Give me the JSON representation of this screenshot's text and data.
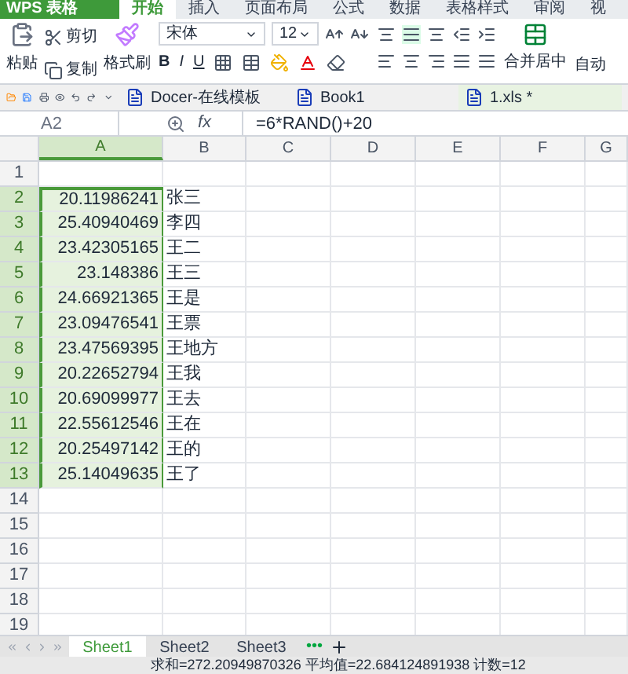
{
  "app_menu": {
    "label": "WPS 表格"
  },
  "menu_tabs": [
    {
      "label": "开始",
      "selected": true
    },
    {
      "label": "插入",
      "selected": false
    },
    {
      "label": "页面布局",
      "selected": false
    },
    {
      "label": "公式",
      "selected": false
    },
    {
      "label": "数据",
      "selected": false
    },
    {
      "label": "表格样式",
      "selected": false
    },
    {
      "label": "审阅",
      "selected": false
    },
    {
      "label": "视",
      "selected": false
    }
  ],
  "ribbon": {
    "paste": "粘贴",
    "cut": "剪切",
    "copy": "复制",
    "format_painter": "格式刷",
    "font": "宋体",
    "font_size": "12",
    "bold": "B",
    "italic": "I",
    "underline": "U",
    "merge": "合并居中",
    "auto": "自动"
  },
  "doc_tabs": [
    {
      "label": "Docer-在线模板",
      "selected": false
    },
    {
      "label": "Book1",
      "selected": false
    },
    {
      "label": "1.xls *",
      "selected": true
    }
  ],
  "formula_bar": {
    "name_box": "A2",
    "fx": "fx",
    "formula": "=6*RAND()+20"
  },
  "columns": [
    {
      "label": "A",
      "selected": true
    },
    {
      "label": "B",
      "selected": false
    },
    {
      "label": "C",
      "selected": false
    },
    {
      "label": "D",
      "selected": false
    },
    {
      "label": "E",
      "selected": false
    },
    {
      "label": "F",
      "selected": false
    },
    {
      "label": "G",
      "selected": false
    }
  ],
  "rows": [
    {
      "label": "1",
      "selected": false
    },
    {
      "label": "2",
      "selected": true,
      "a": "20.11986241",
      "b": "张三"
    },
    {
      "label": "3",
      "selected": true,
      "a": "25.40940469",
      "b": "李四"
    },
    {
      "label": "4",
      "selected": true,
      "a": "23.42305165",
      "b": "王二"
    },
    {
      "label": "5",
      "selected": true,
      "a": "23.148386",
      "b": "王三"
    },
    {
      "label": "6",
      "selected": true,
      "a": "24.66921365",
      "b": "王是"
    },
    {
      "label": "7",
      "selected": true,
      "a": "23.09476541",
      "b": "王票"
    },
    {
      "label": "8",
      "selected": true,
      "a": "23.47569395",
      "b": "王地方"
    },
    {
      "label": "9",
      "selected": true,
      "a": "20.22652794",
      "b": "王我"
    },
    {
      "label": "10",
      "selected": true,
      "a": "20.69099977",
      "b": "王去"
    },
    {
      "label": "11",
      "selected": true,
      "a": "22.55612546",
      "b": "王在"
    },
    {
      "label": "12",
      "selected": true,
      "a": "20.25497142",
      "b": "王的"
    },
    {
      "label": "13",
      "selected": true,
      "a": "25.14049635",
      "b": "王了"
    },
    {
      "label": "14",
      "selected": false
    },
    {
      "label": "15",
      "selected": false
    },
    {
      "label": "16",
      "selected": false
    },
    {
      "label": "17",
      "selected": false
    },
    {
      "label": "18",
      "selected": false
    },
    {
      "label": "19",
      "selected": false
    }
  ],
  "sheet_tabs": [
    {
      "label": "Sheet1",
      "selected": true
    },
    {
      "label": "Sheet2",
      "selected": false
    },
    {
      "label": "Sheet3",
      "selected": false
    }
  ],
  "sheet_more": "•••",
  "status_bar": "求和=272.20949870326  平均值=22.684124891938  计数=12"
}
